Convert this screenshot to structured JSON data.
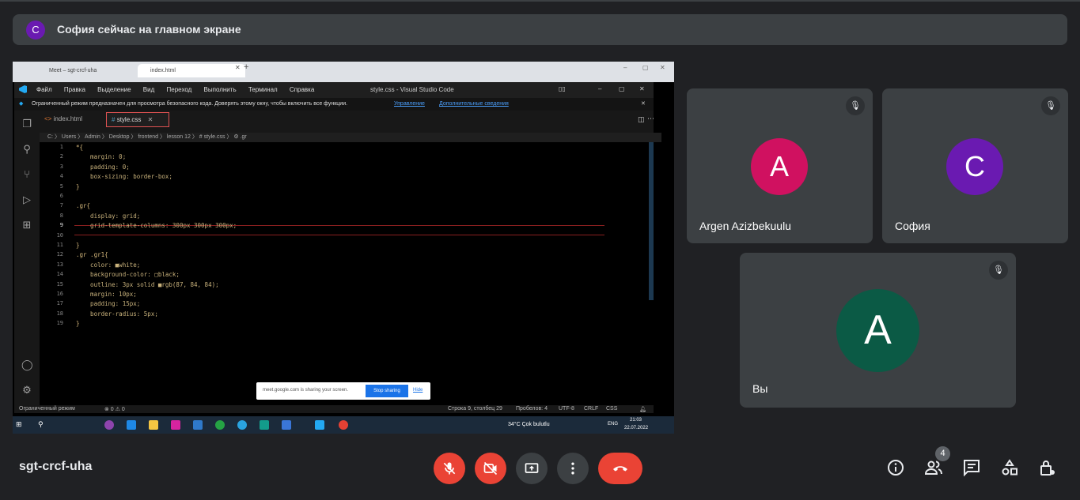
{
  "banner": {
    "avatar_letter": "С",
    "avatar_color": "#6a1ab1",
    "text": "София сейчас на главном экране"
  },
  "shared_screen": {
    "browser_tabs": [
      "Meet – sgt-crcf-uha",
      "index.html"
    ],
    "vscode": {
      "menu": [
        "Файл",
        "Правка",
        "Выделение",
        "Вид",
        "Переход",
        "Выполнить",
        "Терминал",
        "Справка"
      ],
      "window_title": "style.css - Visual Studio Code",
      "restricted_notice": "Ограниченный режим предназначен для просмотра безопасного кода. Доверять этому окну, чтобы включить все функции.",
      "restricted_link_manage": "Управление",
      "restricted_link_more": "Дополнительные сведения",
      "tabs": [
        "index.html",
        "style.css"
      ],
      "breadcrumb": "C: 〉 Users 〉 Admin 〉 Desktop 〉 frontend 〉 lesson 12 〉 # style.css 〉 ⚙ .gr",
      "lines": [
        "*{",
        "    margin: 0;",
        "    padding: 0;",
        "    box-sizing: border-box;",
        "}",
        "",
        ".gr{",
        "    display: grid;",
        "    grid-template-columns: 300px 300px 300px;",
        "",
        "}",
        ".gr .gr1{",
        "    color: ■white;",
        "    background-color: □black;",
        "    outline: 3px solid ■rgb(87, 84, 84);",
        "    margin: 10px;",
        "    padding: 15px;",
        "    border-radius: 5px;",
        "}"
      ],
      "status_left": "Ограниченный режим",
      "status_problems": "⊗ 0 ⚠ 0",
      "status_position": "Строка 9, столбец 29",
      "status_spaces": "Пробелов: 4",
      "status_encoding": "UTF-8",
      "status_eol": "CRLF",
      "status_lang": "CSS"
    },
    "share_notice": {
      "text": "meet.google.com is sharing your screen.",
      "stop": "Stop sharing",
      "hide": "Hide"
    },
    "taskbar": {
      "weather": "34°C  Çok bulutlu",
      "lang": "ENG",
      "time": "21:03",
      "date": "22.07.2022"
    }
  },
  "participants": [
    {
      "name": "Argen Azizbekuulu",
      "letter": "A",
      "color": "#d01160"
    },
    {
      "name": "София",
      "letter": "С",
      "color": "#6a1ab1"
    },
    {
      "name": "Вы",
      "letter": "A",
      "color": "#0b5a45"
    }
  ],
  "meeting_code": "sgt-crcf-uha",
  "people_count": "4",
  "colors": {
    "end_call": "#ea4335",
    "muted": "#ea4335",
    "button": "#3c4043"
  }
}
